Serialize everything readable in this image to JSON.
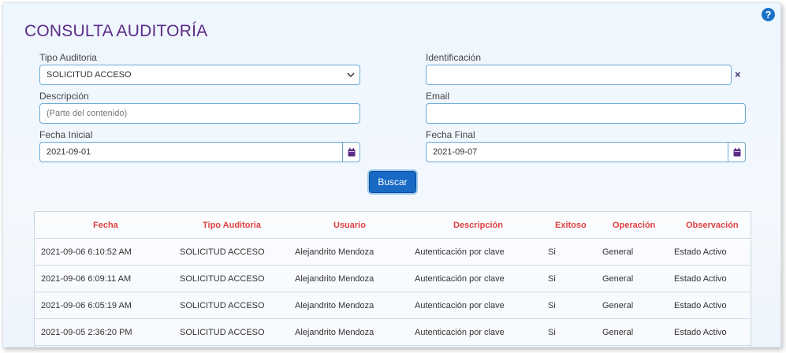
{
  "page": {
    "title": "CONSULTA AUDITORÍA",
    "help": "?"
  },
  "form": {
    "tipo_label": "Tipo Auditoria",
    "tipo_value": "SOLICITUD ACCESO",
    "identificacion_label": "Identificación",
    "identificacion_value": "",
    "clear_symbol": "×",
    "descripcion_label": "Descripción",
    "descripcion_placeholder": "(Parte del contenido)",
    "email_label": "Email",
    "email_value": "",
    "fecha_inicial_label": "Fecha Inicial",
    "fecha_inicial_value": "2021-09-01",
    "fecha_final_label": "Fecha Final",
    "fecha_final_value": "2021-09-07",
    "buscar_label": "Buscar"
  },
  "table": {
    "headers": [
      "Fecha",
      "Tipo Auditoria",
      "Usuario",
      "Descripción",
      "Exitoso",
      "Operación",
      "Observación"
    ],
    "rows": [
      [
        "2021-09-06 6:10:52 AM",
        "SOLICITUD ACCESO",
        "Alejandrito Mendoza",
        "Autenticación por clave",
        "Si",
        "General",
        "Estado Activo"
      ],
      [
        "2021-09-06 6:09:11 AM",
        "SOLICITUD ACCESO",
        "Alejandrito Mendoza",
        "Autenticación por clave",
        "Si",
        "General",
        "Estado Activo"
      ],
      [
        "2021-09-06 6:05:19 AM",
        "SOLICITUD ACCESO",
        "Alejandrito Mendoza",
        "Autenticación por clave",
        "Si",
        "General",
        "Estado Activo"
      ],
      [
        "2021-09-05 2:36:20 PM",
        "SOLICITUD ACCESO",
        "Alejandrito Mendoza",
        "Autenticación por clave",
        "Si",
        "General",
        "Estado Activo"
      ]
    ]
  },
  "colors": {
    "title": "#5b2a86",
    "header_text": "#e04040",
    "button": "#1769c4",
    "field_border": "#6aa9d8"
  },
  "icons": [
    "help-icon",
    "chevron-down-icon",
    "calendar-icon",
    "close-icon"
  ]
}
